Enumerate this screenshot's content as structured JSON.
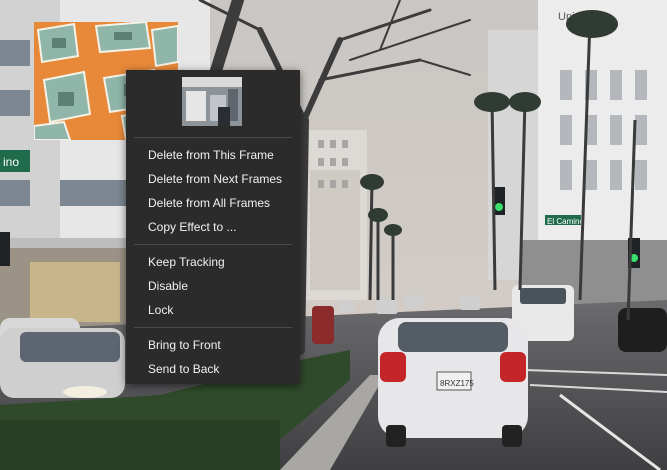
{
  "context_menu": {
    "items": [
      {
        "label": "Delete from This Frame"
      },
      {
        "label": "Delete from Next Frames"
      },
      {
        "label": "Delete from All Frames"
      },
      {
        "label": "Copy Effect to ..."
      },
      {
        "label": "Keep Tracking"
      },
      {
        "label": "Disable"
      },
      {
        "label": "Lock"
      },
      {
        "label": "Bring to Front"
      },
      {
        "label": "Send to Back"
      }
    ]
  },
  "scene": {
    "street_sign": "ino",
    "cross_sign": "El Camino",
    "plate": "8RXZ175",
    "building_sign": "Uni"
  },
  "colors": {
    "menu_bg": "#2b2b2b",
    "menu_text": "#f2f2f2",
    "overlay_orange": "#e8893a"
  }
}
